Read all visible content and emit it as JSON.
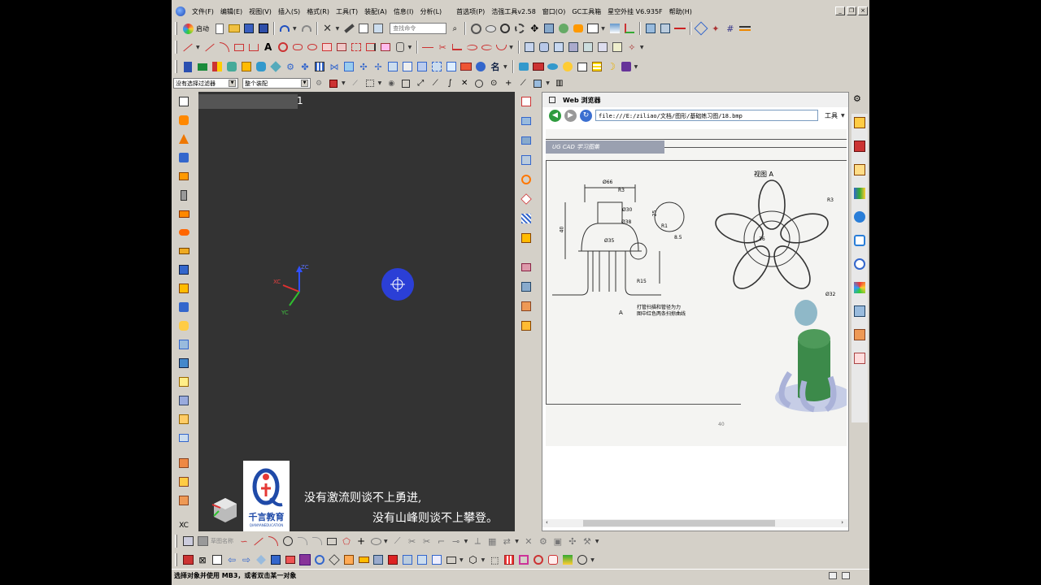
{
  "menu": {
    "items": [
      "文件(F)",
      "编辑(E)",
      "视图(V)",
      "插入(S)",
      "格式(R)",
      "工具(T)",
      "装配(A)",
      "信息(I)",
      "分析(L)",
      "首选项(P)",
      "浩强工具v2.58",
      "窗口(O)",
      "GC工具箱",
      "星空外挂 V6.935F",
      "帮助(H)"
    ]
  },
  "toolbar": {
    "start_label": "启动",
    "search_placeholder": "查找命令",
    "filter_value": "没有选择过滤器",
    "assembly_value": "整个装配"
  },
  "viewport": {
    "tab_number": "1",
    "axis_zc": "ZC",
    "axis_xc": "XC",
    "axis_yc": "YC"
  },
  "watermark": {
    "brand": "千言教育",
    "brand_en": "QIANYANEDUCATION",
    "line1": "没有激流则谈不上勇进,",
    "line2": "没有山峰则谈不上攀登。"
  },
  "browser": {
    "title": "Web 浏览器",
    "address": "file:///E:/ziliao/文档/图形/基础练习图/18.bmp",
    "tools_label": "工具",
    "doc_header": "UG CAD 学习图集",
    "view_label": "视图 A",
    "section_label": "A",
    "note_line1": "打管扫描和管径为力",
    "note_line2": "图中红色两条扫掠曲线",
    "page_number": "40",
    "dims": [
      "Ø66",
      "R3",
      "Ø30",
      "Ø38",
      "Ø35",
      "R15",
      "40",
      "25",
      "R3",
      "Ø32",
      "R1",
      "8.5",
      "36"
    ]
  },
  "status": {
    "prompt": "选择对象并使用 MB3，或者双击某一对象"
  }
}
